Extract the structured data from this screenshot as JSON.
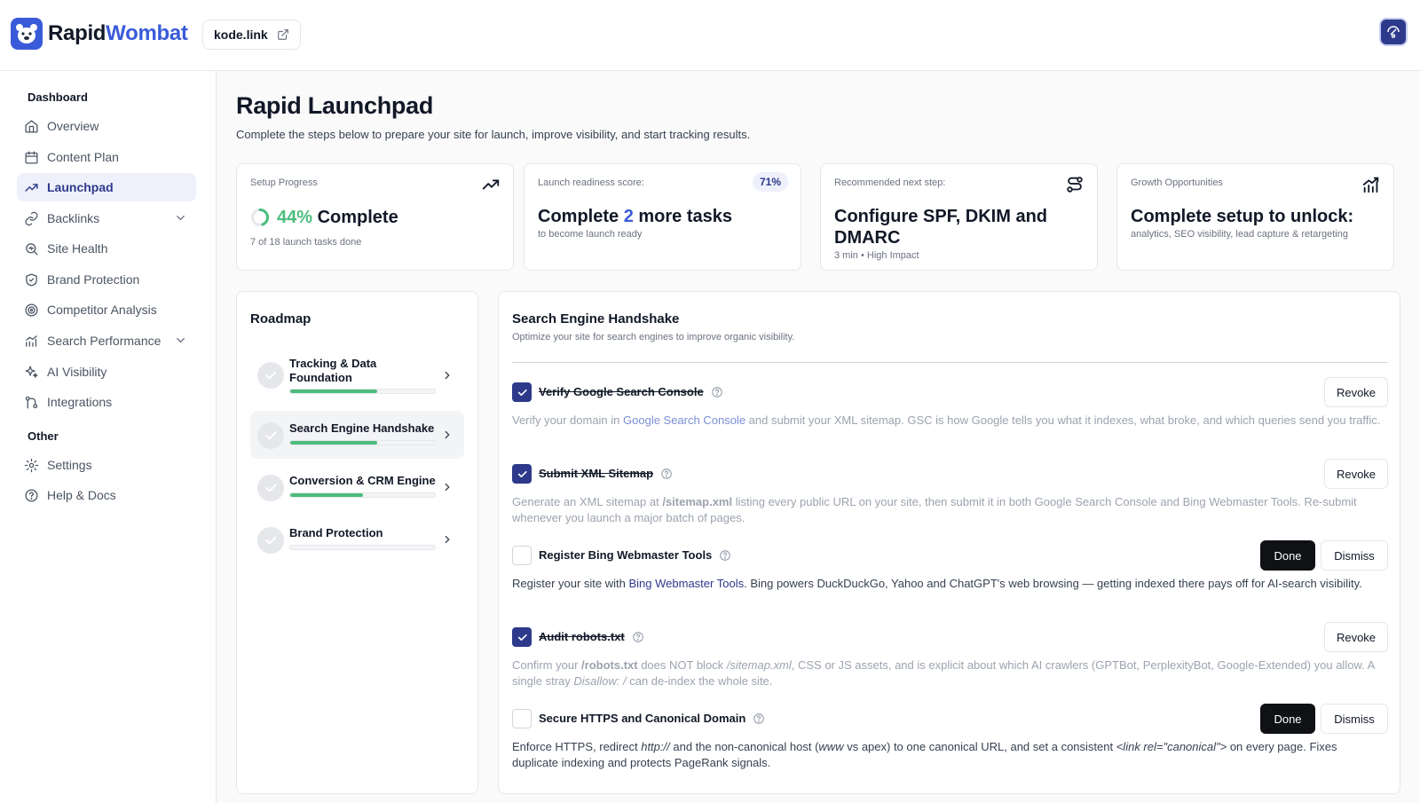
{
  "header": {
    "logo_part1": "Rapid",
    "logo_part2": "Wombat",
    "domain": "kode.link"
  },
  "sidebar": {
    "section1": "Dashboard",
    "section2": "Other",
    "items": [
      {
        "label": "Overview"
      },
      {
        "label": "Content Plan"
      },
      {
        "label": "Launchpad"
      },
      {
        "label": "Backlinks"
      },
      {
        "label": "Site Health"
      },
      {
        "label": "Brand Protection"
      },
      {
        "label": "Competitor Analysis"
      },
      {
        "label": "Search Performance"
      },
      {
        "label": "AI Visibility"
      },
      {
        "label": "Integrations"
      },
      {
        "label": "Settings"
      },
      {
        "label": "Help & Docs"
      }
    ]
  },
  "page": {
    "title": "Rapid Launchpad",
    "subtitle": "Complete the steps below to prepare your site for launch, improve visibility, and start tracking results."
  },
  "stats": {
    "progress": {
      "label": "Setup Progress",
      "value": "44%",
      "value_suffix": " Complete",
      "note": "7 of 18 launch tasks done",
      "fraction": 0.44
    },
    "readiness": {
      "label": "Launch readiness score:",
      "badge": "71%",
      "pre": "Complete ",
      "count": "2",
      "post": " more tasks",
      "note": "to become launch ready"
    },
    "next": {
      "label": "Recommended next step:",
      "headline": "Configure SPF, DKIM and DMARC",
      "note_time": "3 min",
      "note_sep": "•",
      "note_impact": "High Impact"
    },
    "growth": {
      "label": "Growth Opportunities",
      "headline": "Complete setup to unlock:",
      "note": "analytics, SEO visibility, lead capture & retargeting"
    }
  },
  "roadmap": {
    "title": "Roadmap",
    "items": [
      {
        "label": "Tracking & Data Foundation",
        "progress": 0.6
      },
      {
        "label": "Search Engine Handshake",
        "progress": 0.6
      },
      {
        "label": "Conversion & CRM Engine",
        "progress": 0.5
      },
      {
        "label": "Brand Protection",
        "progress": 0
      }
    ]
  },
  "section": {
    "title": "Search Engine Handshake",
    "subtitle": "Optimize your site for search engines to improve organic visibility."
  },
  "tasks": [
    {
      "name": "Verify Google Search Console",
      "done": true,
      "d1": "Verify your domain in ",
      "link": "Google Search Console",
      "d2": " and submit your XML sitemap. GSC is how Google tells you what it indexes, what broke, and which queries send you traffic."
    },
    {
      "name": "Submit XML Sitemap",
      "done": true,
      "d1": "Generate an XML sitemap at ",
      "code": "/sitemap.xml",
      "d2": " listing every public URL on your site, then submit it in both Google Search Console and Bing Webmaster Tools. Re-submit whenever you launch a major batch of pages."
    },
    {
      "name": "Register Bing Webmaster Tools",
      "done": false,
      "d1": "Register your site with ",
      "link": "Bing Webmaster Tools",
      "d2": ". Bing powers DuckDuckGo, Yahoo and ChatGPT's web browsing — getting indexed there pays off for AI-search visibility."
    },
    {
      "name": "Audit robots.txt",
      "done": true,
      "d1": "Confirm your ",
      "code": "/robots.txt",
      "d2": " does NOT block ",
      "i1": "/sitemap.xml",
      "d3": ", CSS or JS assets, and is explicit about which AI crawlers (GPTBot, PerplexityBot, Google-Extended) you allow. A single stray ",
      "i2": "Disallow: /",
      "d4": " can de-index the whole site."
    },
    {
      "name": "Secure HTTPS and Canonical Domain",
      "done": false,
      "d1": "Enforce HTTPS, redirect ",
      "i1": "http://",
      "d2": " and the non-canonical host (",
      "i2": "www",
      "d3": " vs apex) to one canonical URL, and set a consistent ",
      "i3": "<link rel=\"canonical\">",
      "d4": " on every page. Fixes duplicate indexing and protects PageRank signals."
    }
  ],
  "buttons": {
    "revoke": "Revoke",
    "done": "Done",
    "dismiss": "Dismiss"
  },
  "colors": {
    "brand": "#3a5bd9",
    "accent": "#2d3a8c",
    "success": "#4cbd7d",
    "dark": "#0f1115"
  }
}
